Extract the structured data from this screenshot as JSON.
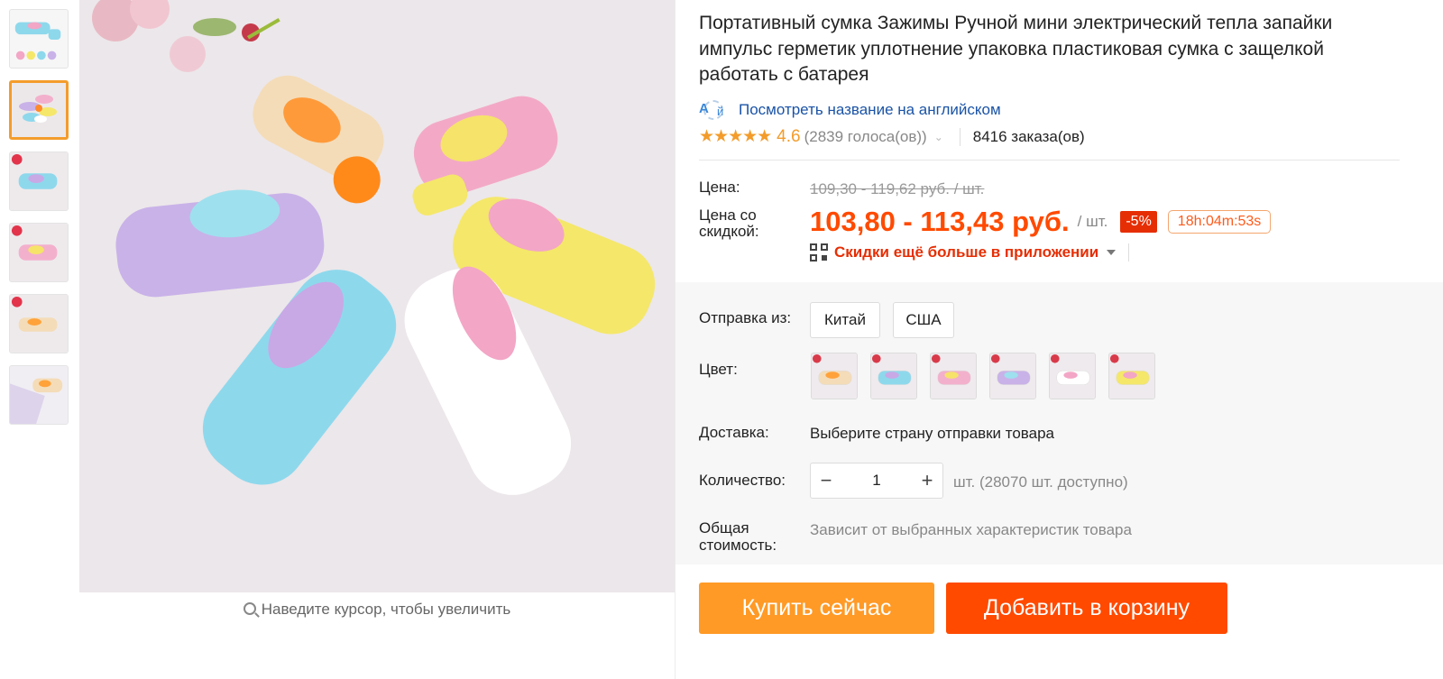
{
  "product": {
    "title": "Портативный сумка Зажимы Ручной мини электрический тепла запайки импульс герметик уплотнение упаковка пластиковая сумка с защелкой работать с батарея",
    "translate_link": "Посмотреть название на английском",
    "rating": {
      "stars": "★★★★★",
      "value": "4.6",
      "votes": "(2839 голоса(ов))",
      "orders": "8416 заказа(ов)"
    }
  },
  "price": {
    "label": "Цена:",
    "old": "109,30 - 119,62 руб. / шт.",
    "discount_label": "Цена со скидкой:",
    "new": "103,80 - 113,43 руб.",
    "per_unit": "/ шт.",
    "discount_badge": "-5%",
    "timer": "18h:04m:53s",
    "app_promo": "Скидки ещё больше в приложении"
  },
  "options": {
    "ship_from_label": "Отправка из:",
    "ship_from": [
      "Китай",
      "США"
    ],
    "color_label": "Цвет:",
    "color_swatches": [
      {
        "body": "#f4dcb8",
        "button": "#ffa23a"
      },
      {
        "body": "#8ed8ec",
        "button": "#c9a8e6"
      },
      {
        "body": "#f3b0cc",
        "button": "#f6e36a"
      },
      {
        "body": "#c9b2e8",
        "button": "#9fe0ee"
      },
      {
        "body": "#ffffff",
        "button": "#f3a6c6"
      },
      {
        "body": "#f5e76a",
        "button": "#f3a6c6"
      }
    ],
    "delivery_label": "Доставка:",
    "delivery_text": "Выберите страну отправки товара",
    "quantity_label": "Количество:",
    "quantity_value": "1",
    "quantity_minus": "−",
    "quantity_plus": "+",
    "quantity_available": "шт. (28070 шт. доступно)",
    "total_label": "Общая стоимость:",
    "total_text": "Зависит от выбранных характеристик товара"
  },
  "buttons": {
    "buy_now": "Купить сейчас",
    "add_to_cart": "Добавить в корзину"
  },
  "gallery": {
    "zoom_hint": "Наведите курсор, чтобы увеличить",
    "thumbnail_count": 6,
    "active_thumbnail": 2
  },
  "colors": {
    "accent_orange": "#ff9a26",
    "accent_red": "#ff4a00",
    "link_blue": "#1a53a6",
    "star_orange": "#f39c2b"
  }
}
